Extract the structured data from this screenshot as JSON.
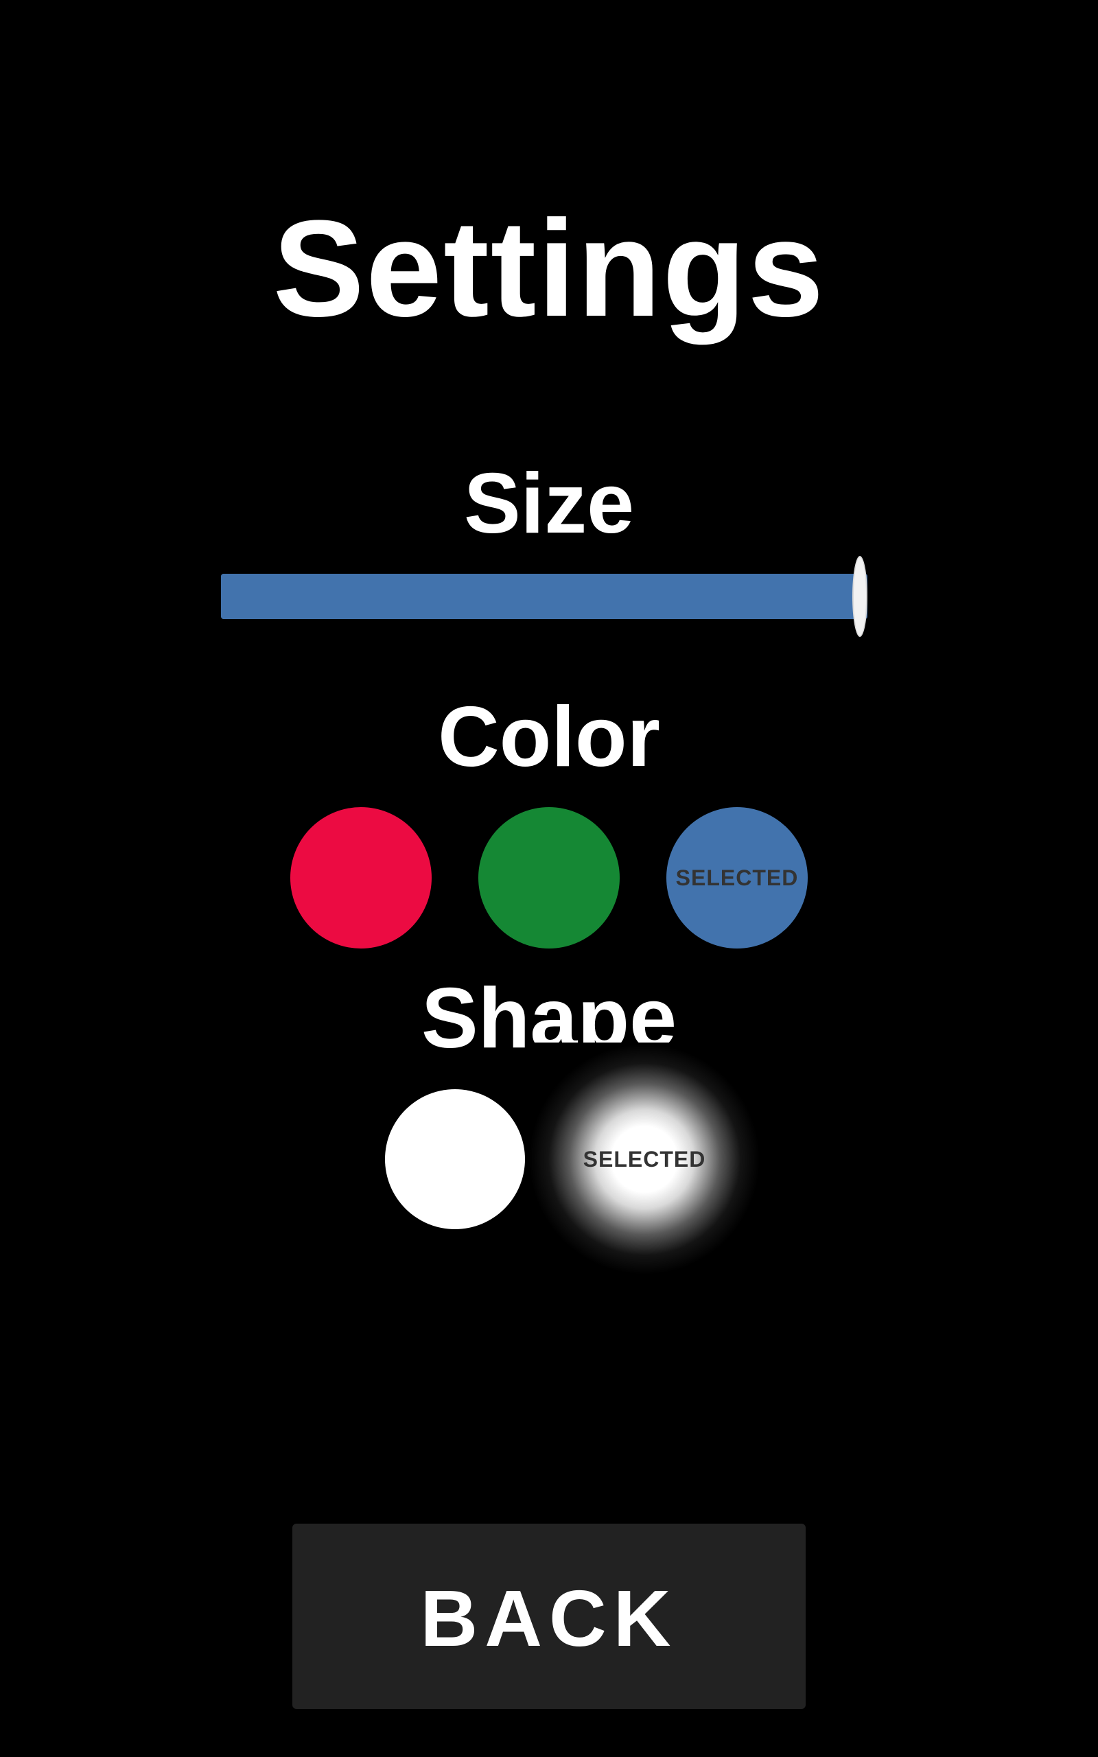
{
  "page": {
    "title": "Settings"
  },
  "size": {
    "label": "Size",
    "value_percent": 100,
    "fill_color": "#4273ad"
  },
  "color": {
    "label": "Color",
    "options": [
      {
        "name": "red",
        "color": "#ec0b42",
        "selected": false,
        "badge": ""
      },
      {
        "name": "green",
        "color": "#158834",
        "selected": false,
        "badge": ""
      },
      {
        "name": "blue",
        "color": "#4273ad",
        "selected": true,
        "badge": "SELECTED"
      }
    ]
  },
  "shape": {
    "label": "Shape",
    "options": [
      {
        "name": "solid-circle",
        "selected": false,
        "badge": ""
      },
      {
        "name": "soft-glow",
        "selected": true,
        "badge": "SELECTED"
      }
    ]
  },
  "back_button": {
    "label": "BACK"
  }
}
